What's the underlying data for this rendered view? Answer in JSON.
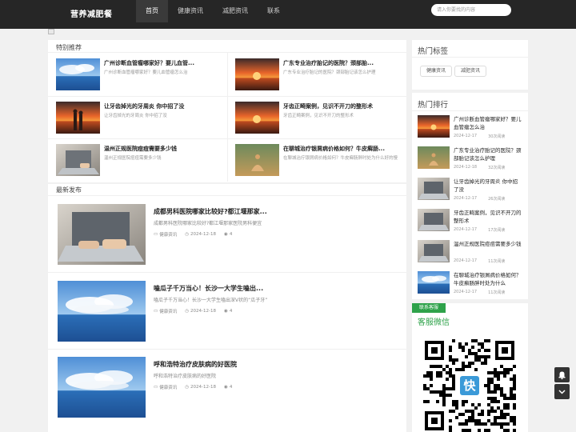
{
  "header": {
    "logo": "营养减肥餐",
    "nav": [
      "首页",
      "健康资讯",
      "减肥资讯",
      "联系"
    ],
    "search_placeholder": "请入你要找的内容"
  },
  "featured": {
    "title": "特别推荐",
    "items": [
      {
        "title": "广州诊断血管瘤哪家好？要儿血管...",
        "desc": "广州诊断血管瘤哪家好？要儿血管瘤怎么治",
        "thumb": "sea-sky-image"
      },
      {
        "title": "广东专业治疗胎记的医院？颈部胎...",
        "desc": "广东专业治疗胎记的医院？颈部胎记该怎么护理",
        "thumb": "sunset-image"
      },
      {
        "title": "让牙齿掉光的牙周炎 你中招了没",
        "desc": "让牙齿掉光的牙周炎 你中招了没",
        "thumb": "couple-sunset-image"
      },
      {
        "title": "牙齿正畸案例，见识不开刀的整形术",
        "desc": "牙齿正畸案例，见识不开刀的整形术",
        "thumb": "sunset-image"
      },
      {
        "title": "温州正规医院痘痘需要多少钱",
        "desc": "温州正规医院痘痘需要多少钱",
        "thumb": "laptop-image"
      },
      {
        "title": "在聊城治疗银屑病价格如何？牛皮癣肠...",
        "desc": "在聊城治疗银屑病价格如何？牛皮癣肠胖时处为什么好的慢",
        "thumb": "meditation-image"
      }
    ]
  },
  "latest": {
    "title": "最新发布",
    "posts": [
      {
        "title": "成都男科医院哪家比较好?都江堰那家...",
        "desc": "成都男科医院哪家比较好?都江堰那家医院男科便宜",
        "category": "健康资讯",
        "date": "2024-12-18",
        "views": "4",
        "thumb": "laptop-image"
      },
      {
        "title": "嗑瓜子千万当心！长沙一大学生嗑出...",
        "desc": "嗑瓜子千万当心！长沙一大学生嗑出深V状的“瓜子牙”",
        "category": "健康资讯",
        "date": "2024-12-18",
        "views": "4",
        "thumb": "sea-sky-image"
      },
      {
        "title": "呼和浩特治疗皮肤病的好医院",
        "desc": "呼和浩特治疗皮肤病的好医院",
        "category": "健康资讯",
        "date": "2024-12-18",
        "views": "4",
        "thumb": "sea-sky-image"
      }
    ]
  },
  "sidebar": {
    "tags_title": "热门标签",
    "tags": [
      "健康资讯",
      "减肥资讯"
    ],
    "rank_title": "热门排行",
    "rank": [
      {
        "title": "广州诊断血管瘤哪家好？要儿血管瘤怎么治",
        "date": "2024-12-17",
        "views": "30次阅读",
        "thumb": "sunset-image"
      },
      {
        "title": "广东专业治疗胎记的医院？颈部胎记该怎么护理",
        "date": "2024-12-18",
        "views": "32次阅读",
        "thumb": "meditation-image"
      },
      {
        "title": "让牙齿掉光的牙周炎 你中招了没",
        "date": "2024-12-17",
        "views": "26次阅读",
        "thumb": "laptop-image"
      },
      {
        "title": "牙齿正畸案例，见识不开刀的整形术",
        "date": "2024-12-17",
        "views": "17次阅读",
        "thumb": "laptop-image"
      },
      {
        "title": "温州正规医院痘痘需要多少钱",
        "date": "2024-12-17",
        "views": "11次阅读",
        "thumb": "laptop-image"
      },
      {
        "title": "在聊城治疗银屑病价格如何？牛皮癣肠胖时处为什么",
        "date": "2024-12-17",
        "views": "11次阅读",
        "thumb": "sea-sky-image"
      }
    ],
    "contact_badge": "联系客服",
    "contact_title": "客服微信",
    "qr_center": "快"
  },
  "icons": {
    "category": "folder-icon",
    "date": "clock-icon",
    "views": "eye-icon",
    "float_top": "bell-icon",
    "float_bottom": "chevron-down-icon"
  },
  "colors": {
    "header_bg": "#262626",
    "accent_green": "#2ea24a",
    "qr_blue": "#3b9ad8"
  }
}
